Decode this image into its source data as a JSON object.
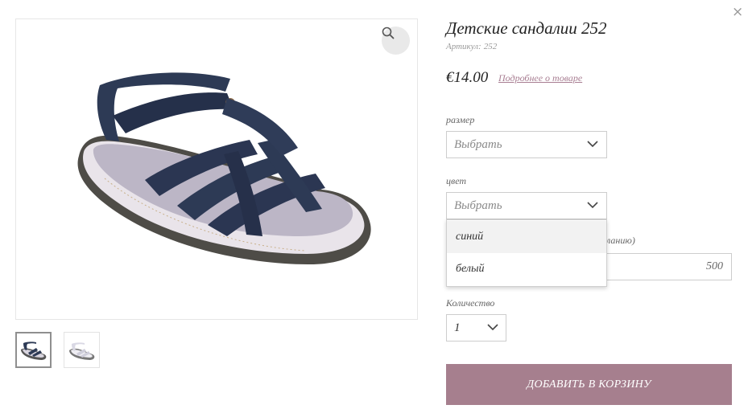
{
  "modal": {
    "close_glyph": "×"
  },
  "product": {
    "title": "Детские сандалии 252",
    "sku_label": "Артикул:",
    "sku_value": "252",
    "price": "€14.00",
    "details_link": "Подробнее о товаре",
    "image_alt_icons": [
      "sandal-image",
      "zoom-icon"
    ]
  },
  "options": {
    "size": {
      "label": "размер",
      "value": "Выбрать"
    },
    "color": {
      "label": "цвет",
      "value": "Выбрать",
      "options": [
        "синий",
        "белый"
      ],
      "highlighted": "синий"
    },
    "comment": {
      "label": "желанию)",
      "value": "500"
    },
    "quantity": {
      "label": "Количество",
      "value": "1"
    }
  },
  "cart": {
    "add_label": "Добавить в корзину",
    "button_color": "#a67f8e"
  },
  "colors": {
    "accent": "#a67f8e",
    "link": "#a87e92",
    "navy_sandal": "#2d3a55",
    "sole": "#4a4a46"
  }
}
